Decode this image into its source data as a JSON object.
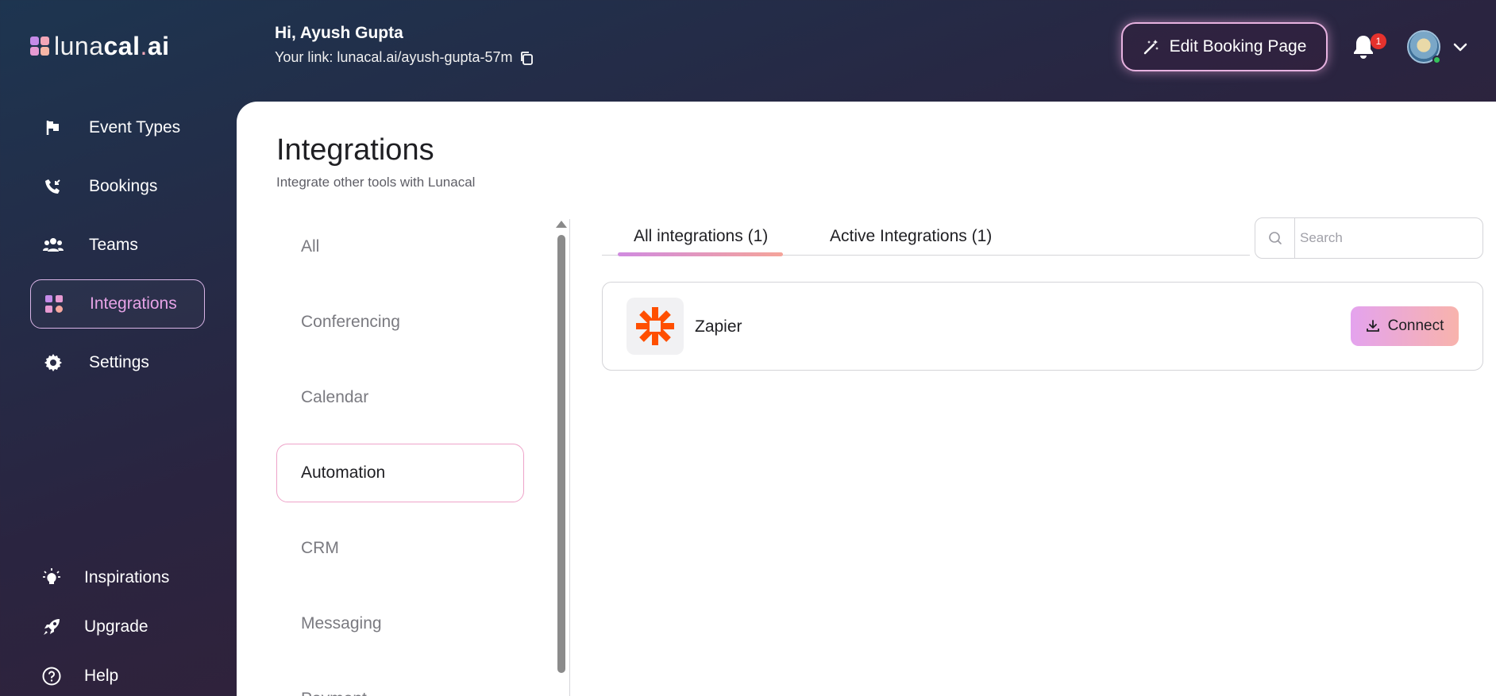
{
  "brand": {
    "logo_thin": "luna",
    "logo_bold": "cal",
    "logo_dot": ".",
    "logo_suffix": "ai"
  },
  "header": {
    "greeting": "Hi, Ayush Gupta",
    "link_text": "Your link: lunacal.ai/ayush-gupta-57m",
    "edit_button": "Edit Booking Page",
    "notification_count": "1"
  },
  "sidebar": {
    "items": [
      {
        "label": "Event Types",
        "icon": "flag-icon"
      },
      {
        "label": "Bookings",
        "icon": "phone-incoming-icon"
      },
      {
        "label": "Teams",
        "icon": "users-icon"
      },
      {
        "label": "Integrations",
        "icon": "grid-icon",
        "active": true
      },
      {
        "label": "Settings",
        "icon": "gear-icon"
      }
    ],
    "bottom_items": [
      {
        "label": "Inspirations",
        "icon": "lightbulb-icon"
      },
      {
        "label": "Upgrade",
        "icon": "rocket-icon"
      },
      {
        "label": "Help",
        "icon": "help-circle-icon"
      }
    ]
  },
  "main": {
    "title": "Integrations",
    "subtitle": "Integrate other tools with Lunacal",
    "categories": [
      "All",
      "Conferencing",
      "Calendar",
      "Automation",
      "CRM",
      "Messaging",
      "Payment"
    ],
    "active_category": "Automation",
    "tabs": [
      {
        "label": "All integrations (1)",
        "active": true
      },
      {
        "label": "Active Integrations (1)",
        "active": false
      }
    ],
    "search": {
      "placeholder": "Search",
      "value": ""
    },
    "integrations": [
      {
        "name": "Zapier",
        "action": "Connect"
      }
    ]
  },
  "colors": {
    "accent_pink": "#e6a3e6",
    "zapier_orange": "#ff4f00",
    "badge_red": "#e5322d"
  }
}
